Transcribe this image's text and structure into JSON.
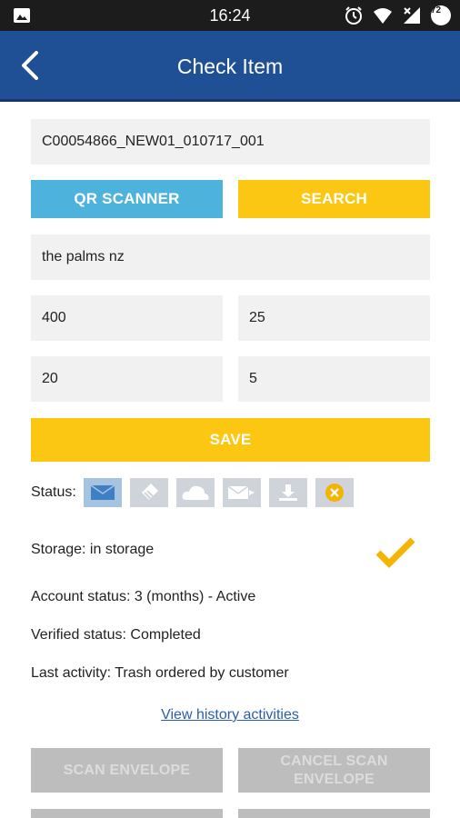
{
  "status_bar": {
    "time": "16:24",
    "battery_level": "72",
    "icons": [
      "image-icon",
      "alarm-icon",
      "wifi-icon",
      "signal-icon",
      "battery-icon"
    ]
  },
  "app_bar": {
    "title": "Check Item",
    "back_icon": "back-arrow-icon"
  },
  "form": {
    "item_code": "C00054866_NEW01_010717_001",
    "qr_scanner_label": "QR SCANNER",
    "search_label": "SEARCH",
    "location": "the palms nz",
    "value_a": "400",
    "value_b": "25",
    "value_c": "20",
    "value_d": "5",
    "save_label": "SAVE"
  },
  "status": {
    "label": "Status:",
    "icons": [
      "envelope-icon",
      "scan-icon",
      "cloud-icon",
      "send-icon",
      "download-icon",
      "cancel-icon"
    ]
  },
  "details": {
    "storage": "Storage: in storage",
    "account_status": "Account status: 3 (months) - Active",
    "verified_status": "Verified status: Completed",
    "last_activity": "Last activity: Trash ordered by customer",
    "history_link": "View history activities"
  },
  "actions": {
    "scan_envelope": "SCAN ENVELOPE",
    "cancel_scan_envelope": "CANCEL SCAN ENVELOPE"
  },
  "colors": {
    "app_bar": "#1f4f94",
    "blue_button": "#4db3dd",
    "yellow_button": "#fcc713",
    "disabled_button": "#bdbdbd",
    "checkmark": "#f4b400"
  }
}
